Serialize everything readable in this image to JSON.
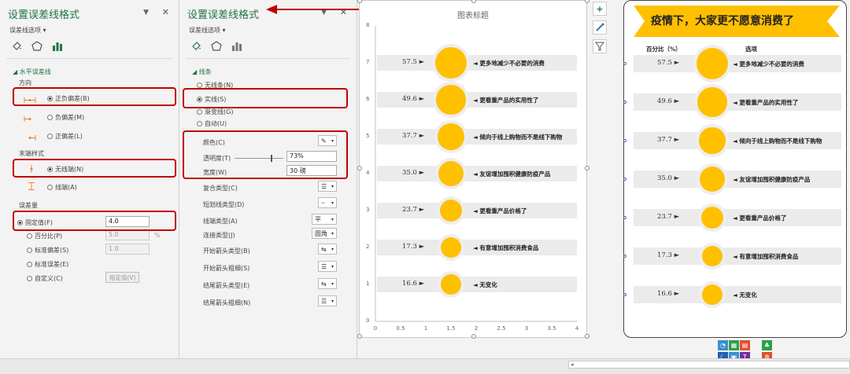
{
  "panel1": {
    "title": "设置误差线格式",
    "subtitle": "误差线选项 ▾",
    "section": "◢ 水平误差线",
    "direction_label": "方向",
    "directions": [
      "正负偏差(B)",
      "负偏差(M)",
      "正偏差(L)"
    ],
    "endstyle_label": "末端样式",
    "endstyles": [
      "无线端(N)",
      "线端(A)"
    ],
    "amount_label": "误差量",
    "amounts": [
      "固定值(F)",
      "百分比(P)",
      "标准偏差(S)",
      "标准误差(E)",
      "自定义(C)"
    ],
    "fixed_value": "4.0",
    "percent_value": "5.0",
    "percent_unit": "%",
    "stddev_value": "1.0",
    "specify_button": "指定值(V)"
  },
  "panel2": {
    "title": "设置误差线格式",
    "subtitle": "误差线选项 ▾",
    "section": "◢ 线条",
    "line_opts": [
      "无线条(N)",
      "实线(S)",
      "渐变线(G)",
      "自动(U)"
    ],
    "color_label": "颜色(C)",
    "transparency_label": "透明度(T)",
    "transparency_value": "73%",
    "width_label": "宽度(W)",
    "width_value": "30 磅",
    "props": [
      "复合类型(C)",
      "短划线类型(D)",
      "线端类型(A)",
      "连接类型(J)",
      "开始箭头类型(B)",
      "开始箭头粗细(S)",
      "结尾箭头类型(E)",
      "结尾箭头粗细(N)"
    ],
    "cap_value": "平",
    "join_value": "圆角"
  },
  "chart1": {
    "title": "图表标题",
    "y_ticks": [
      "0",
      "1",
      "2",
      "3",
      "4",
      "5",
      "6",
      "7",
      "8"
    ],
    "x_ticks": [
      "0",
      "0.5",
      "1",
      "1.5",
      "2",
      "2.5",
      "3",
      "3.5",
      "4"
    ]
  },
  "chart2": {
    "banner": "疫情下，大家更不愿意消费了",
    "col_percent": "百分比（%）",
    "col_option": "选项"
  },
  "chart_data": {
    "type": "scatter",
    "title": "图表标题",
    "categories": [
      "更多地减少不必要的消费",
      "更看重产品的实用性了",
      "倾向于线上购物而不是线下购物",
      "友谊增加囤积健康防疫产品",
      "更看重产品价格了",
      "有意增加囤积消费食品",
      "无变化"
    ],
    "values": [
      57.5,
      49.6,
      37.7,
      35.0,
      23.7,
      17.3,
      16.6
    ],
    "value_labels": [
      "57.5",
      "49.6",
      "37.7",
      "35.0",
      "23.7",
      "17.3",
      "16.6"
    ],
    "y_positions": [
      7,
      6,
      5,
      4,
      3,
      2,
      1
    ],
    "xlim": [
      0,
      4
    ],
    "ylim": [
      0,
      8
    ],
    "marker_color": "#ffc000"
  },
  "colors": {
    "accent": "#217346",
    "highlight": "#c00000",
    "marker": "#ffc000",
    "banner": "#ffc000"
  }
}
